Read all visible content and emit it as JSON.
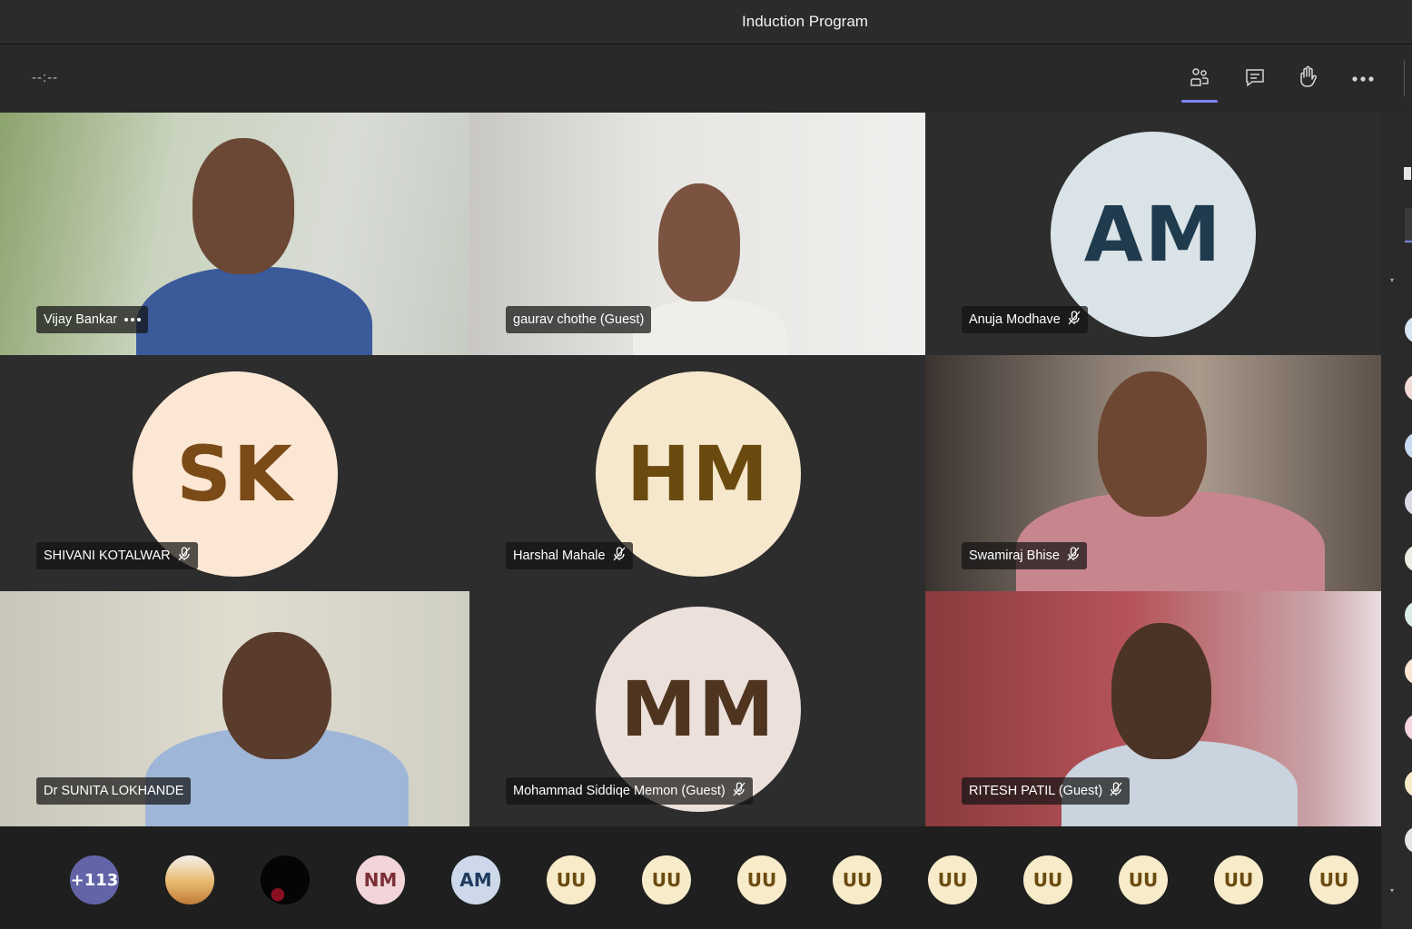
{
  "window": {
    "title": "Induction Program"
  },
  "toolbar": {
    "timer": "--:--"
  },
  "participants": [
    {
      "name": "Vijay Bankar",
      "type": "video",
      "indicator": "more-options"
    },
    {
      "name": "gaurav chothe (Guest)",
      "type": "video",
      "indicator": "none"
    },
    {
      "name": "Anuja Modhave",
      "type": "avatar",
      "initials": "AM",
      "bg": "#d9e3e8",
      "fg": "#1f3b4d",
      "indicator": "muted"
    },
    {
      "name": "SHIVANI KOTALWAR",
      "type": "avatar",
      "initials": "SK",
      "bg": "#fbe7d3",
      "fg": "#7a4a17",
      "indicator": "muted"
    },
    {
      "name": "Harshal Mahale",
      "type": "avatar",
      "initials": "HM",
      "bg": "#f6e8cc",
      "fg": "#6b4a10",
      "indicator": "muted"
    },
    {
      "name": "Swamiraj Bhise",
      "type": "video",
      "indicator": "muted"
    },
    {
      "name": "Dr SUNITA LOKHANDE",
      "type": "video",
      "indicator": "none"
    },
    {
      "name": "Mohammad Siddiqe Memon (Guest)",
      "type": "avatar",
      "initials": "MM",
      "bg": "#ece0db",
      "fg": "#4f3520",
      "indicator": "muted"
    },
    {
      "name": "RITESH PATIL (Guest)",
      "type": "video",
      "indicator": "muted"
    }
  ],
  "overflow": [
    {
      "label": "+113",
      "bg": "#6264a7",
      "fg": "#ffffff"
    },
    {
      "label": "",
      "kind": "photo"
    },
    {
      "label": "",
      "kind": "photo-dark"
    },
    {
      "label": "NM",
      "bg": "#f1d5d8",
      "fg": "#7a2e36"
    },
    {
      "label": "AM",
      "bg": "#cdd9ea",
      "fg": "#1f3b5e"
    },
    {
      "label": "UU",
      "bg": "#f7ebc9",
      "fg": "#6b4a10"
    },
    {
      "label": "UU",
      "bg": "#f7ebc9",
      "fg": "#6b4a10"
    },
    {
      "label": "UU",
      "bg": "#f7ebc9",
      "fg": "#6b4a10"
    },
    {
      "label": "UU",
      "bg": "#f7ebc9",
      "fg": "#6b4a10"
    },
    {
      "label": "UU",
      "bg": "#f7ebc9",
      "fg": "#6b4a10"
    },
    {
      "label": "UU",
      "bg": "#f7ebc9",
      "fg": "#6b4a10"
    },
    {
      "label": "UU",
      "bg": "#f7ebc9",
      "fg": "#6b4a10"
    },
    {
      "label": "UU",
      "bg": "#f7ebc9",
      "fg": "#6b4a10"
    },
    {
      "label": "UU",
      "bg": "#f7ebc9",
      "fg": "#6b4a10"
    }
  ],
  "icons": [
    "people-icon",
    "chat-icon",
    "raise-hand-icon",
    "more-icon",
    "mic-off-icon"
  ],
  "colors": {
    "accent": "#7f85f5",
    "stage": "#2d2d2d"
  }
}
